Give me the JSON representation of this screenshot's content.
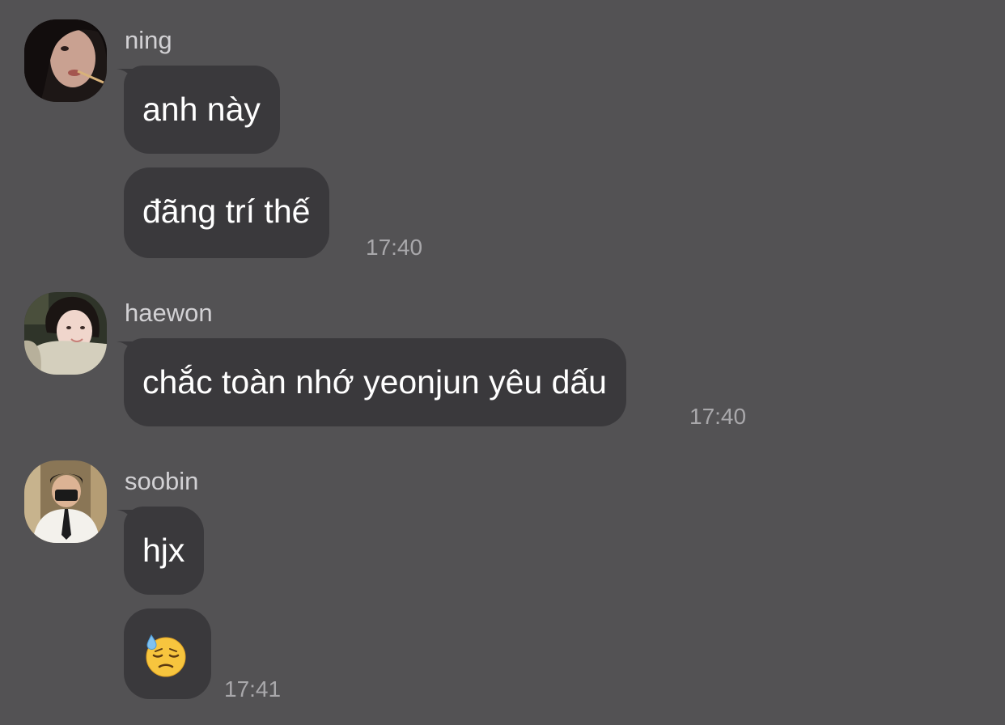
{
  "messages": [
    {
      "sender": "ning",
      "avatar_icon": "avatar-photo-ning",
      "lines": [
        "anh này",
        "đãng trí thế"
      ],
      "time": "17:40"
    },
    {
      "sender": "haewon",
      "avatar_icon": "avatar-photo-haewon",
      "lines": [
        "chắc toàn nhớ yeonjun yêu dấu"
      ],
      "time": "17:40"
    },
    {
      "sender": "soobin",
      "avatar_icon": "avatar-photo-soobin",
      "lines": [
        "hjx"
      ],
      "emoji": "downcast-face-with-sweat",
      "time": "17:41"
    }
  ],
  "colors": {
    "background": "#535254",
    "bubble": "#3a393c",
    "text": "#ffffff",
    "sender": "#d2d1d4",
    "time": "#a9a8ab"
  }
}
